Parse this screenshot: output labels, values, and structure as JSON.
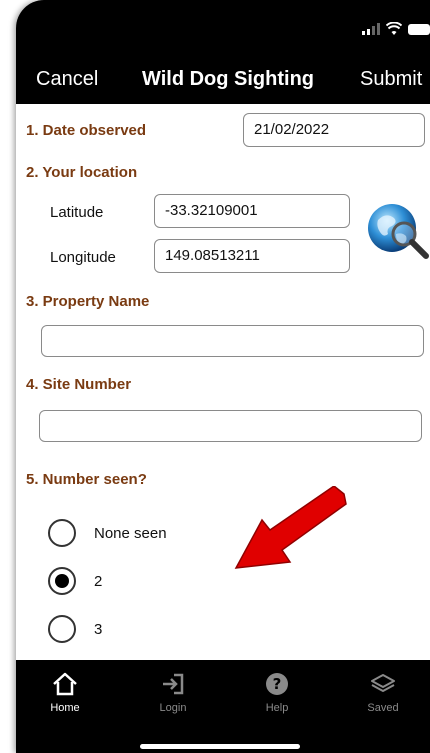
{
  "nav": {
    "cancel": "Cancel",
    "title": "Wild Dog Sighting",
    "submit": "Submit"
  },
  "form": {
    "date": {
      "label": "1. Date observed",
      "value": "21/02/2022"
    },
    "location": {
      "label": "2. Your location",
      "latitude_label": "Latitude",
      "latitude_value": "-33.32109001",
      "longitude_label": "Longitude",
      "longitude_value": "149.08513211"
    },
    "property": {
      "label": "3. Property Name",
      "value": ""
    },
    "site": {
      "label": "4. Site Number",
      "value": ""
    },
    "number_seen": {
      "label": "5. Number seen?",
      "options": [
        {
          "label": "None seen",
          "selected": false
        },
        {
          "label": "2",
          "selected": true
        },
        {
          "label": "3",
          "selected": false
        }
      ]
    }
  },
  "tabs": [
    {
      "label": "Home",
      "icon": "home-icon",
      "active": true
    },
    {
      "label": "Login",
      "icon": "login-icon",
      "active": false
    },
    {
      "label": "Help",
      "icon": "help-icon",
      "active": false
    },
    {
      "label": "Saved",
      "icon": "saved-icon",
      "active": false
    }
  ],
  "colors": {
    "label": "#7a3b12",
    "bar": "#000000",
    "arrow": "#e00000"
  }
}
